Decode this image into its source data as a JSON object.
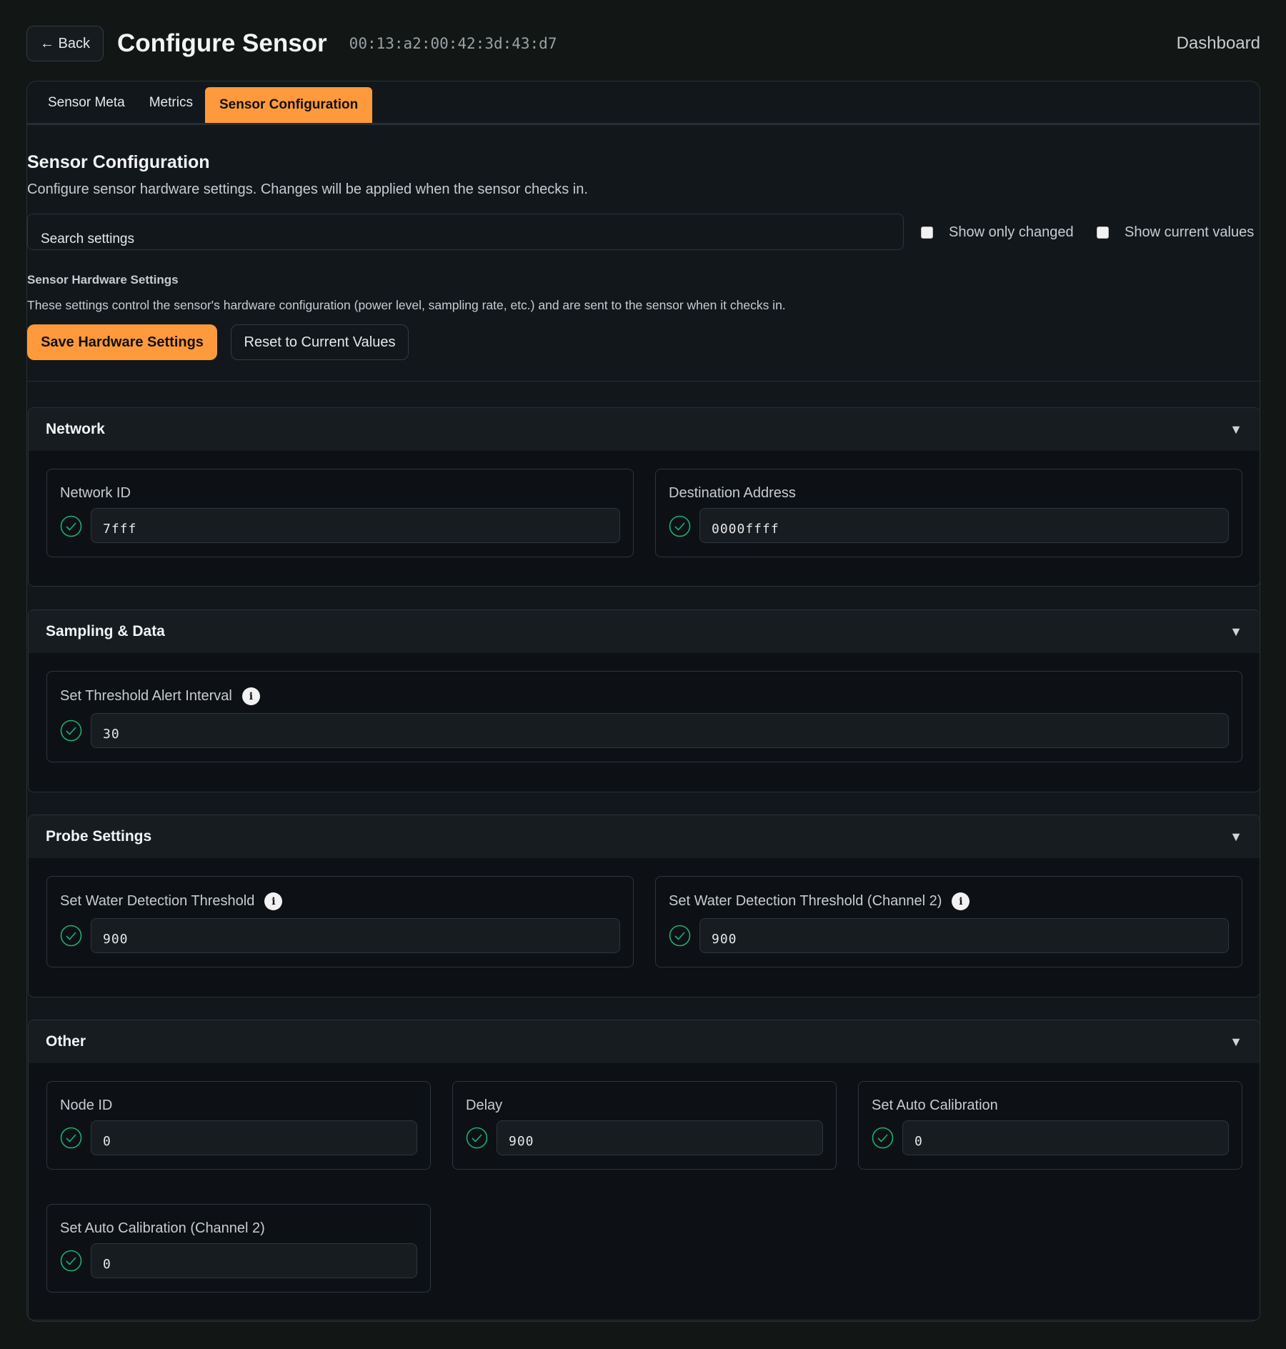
{
  "header": {
    "back_label": "← Back",
    "title": "Configure Sensor",
    "device_id": "00:13:a2:00:42:3d:43:d7",
    "dashboard_label": "Dashboard"
  },
  "tabs": [
    {
      "label": "Sensor Meta",
      "active": false
    },
    {
      "label": "Metrics",
      "active": false
    },
    {
      "label": "Sensor Configuration",
      "active": true
    }
  ],
  "config": {
    "title": "Sensor Configuration",
    "description": "Configure sensor hardware settings. Changes will be applied when the sensor checks in.",
    "search_placeholder": "Search settings",
    "show_only_changed_label": "Show only changed",
    "show_current_values_label": "Show current values",
    "hw_title": "Sensor Hardware Settings",
    "hw_description": "These settings control the sensor's hardware configuration (power level, sampling rate, etc.) and are sent to the sensor when it checks in.",
    "save_label": "Save Hardware Settings",
    "reset_label": "Reset to Current Values"
  },
  "groups": {
    "network": {
      "title": "Network",
      "fields": [
        {
          "label": "Network ID",
          "value": "7fff"
        },
        {
          "label": "Destination Address",
          "value": "0000ffff"
        }
      ]
    },
    "sampling": {
      "title": "Sampling & Data",
      "fields": [
        {
          "label": "Set Threshold Alert Interval",
          "value": "30"
        }
      ]
    },
    "probe": {
      "title": "Probe Settings",
      "fields": [
        {
          "label": "Set Water Detection Threshold",
          "value": "900"
        },
        {
          "label": "Set Water Detection Threshold (Channel 2)",
          "value": "900"
        }
      ]
    },
    "other": {
      "title": "Other",
      "fields": [
        {
          "label": "Node ID",
          "value": "0"
        },
        {
          "label": "Delay",
          "value": "900"
        },
        {
          "label": "Set Auto Calibration",
          "value": "0"
        },
        {
          "label": "Set Auto Calibration (Channel 2)",
          "value": "0"
        }
      ]
    }
  },
  "colors": {
    "accent": "#ff9a3c",
    "ok": "#1fae6e",
    "background": "#121614"
  }
}
